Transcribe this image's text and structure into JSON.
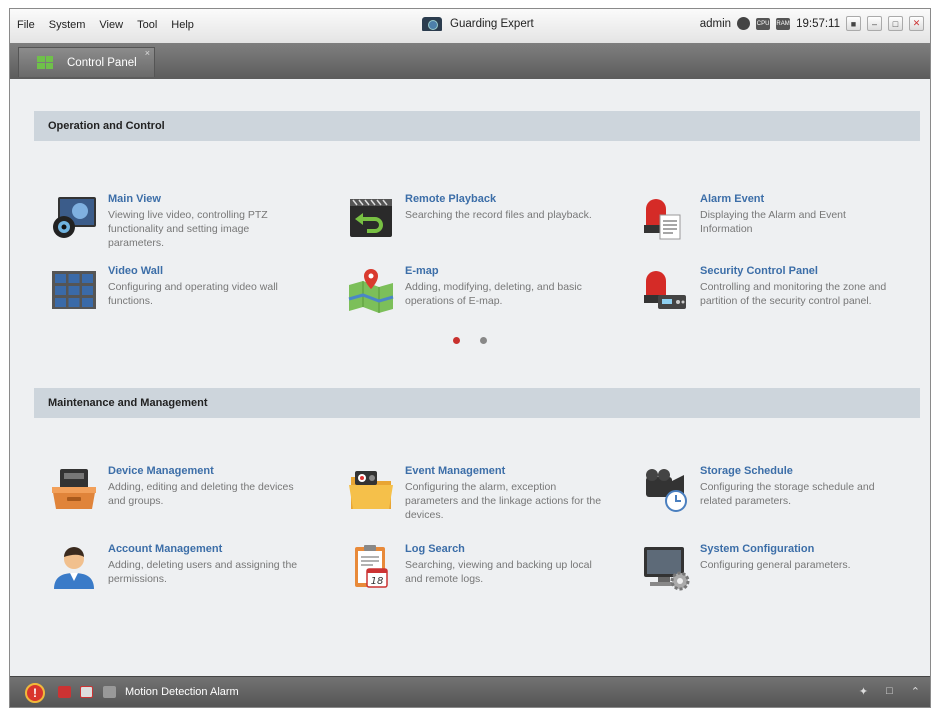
{
  "menubar": {
    "items": [
      "File",
      "System",
      "View",
      "Tool",
      "Help"
    ],
    "app_title": "Guarding Expert",
    "user": "admin",
    "time": "19:57:11",
    "cpu_label": "CPU",
    "ram_label": "RAM"
  },
  "tabs": [
    {
      "label": "Control Panel",
      "close": "×"
    }
  ],
  "sections": [
    {
      "title": "Operation and Control",
      "items": [
        {
          "title": "Main View",
          "desc": "Viewing live video, controlling PTZ functionality and setting image parameters.",
          "icon": "main-view-icon"
        },
        {
          "title": "Remote Playback",
          "desc": "Searching the record files and playback.",
          "icon": "playback-icon"
        },
        {
          "title": "Alarm Event",
          "desc": "Displaying the Alarm and Event Information",
          "icon": "alarm-event-icon"
        },
        {
          "title": "Video Wall",
          "desc": "Configuring and operating video wall functions.",
          "icon": "video-wall-icon"
        },
        {
          "title": "E-map",
          "desc": "Adding, modifying, deleting, and basic operations of E-map.",
          "icon": "emap-icon"
        },
        {
          "title": "Security Control Panel",
          "desc": "Controlling and monitoring the zone and partition of the security control panel.",
          "icon": "security-panel-icon"
        }
      ]
    },
    {
      "title": "Maintenance and Management",
      "items": [
        {
          "title": "Device Management",
          "desc": "Adding, editing and deleting the devices and groups.",
          "icon": "device-management-icon"
        },
        {
          "title": "Event Management",
          "desc": "Configuring the alarm, exception parameters and the linkage actions for the devices.",
          "icon": "event-management-icon"
        },
        {
          "title": "Storage Schedule",
          "desc": "Configuring the storage schedule and related parameters.",
          "icon": "storage-schedule-icon"
        },
        {
          "title": "Account Management",
          "desc": "Adding, deleting users and assigning the permissions.",
          "icon": "account-management-icon"
        },
        {
          "title": "Log Search",
          "desc": "Searching, viewing and backing up local and remote logs.",
          "icon": "log-search-icon"
        },
        {
          "title": "System Configuration",
          "desc": "Configuring general parameters.",
          "icon": "system-configuration-icon"
        }
      ]
    }
  ],
  "pager": {
    "pages": 2,
    "current": 1
  },
  "calendar_day": "18",
  "statusbar": {
    "alarm_text": "Motion Detection Alarm",
    "warn_glyph": "!"
  },
  "colors": {
    "accent": "#3c6ea8",
    "section_bg": "#cdd5dc",
    "active_dot": "#c8312e"
  }
}
